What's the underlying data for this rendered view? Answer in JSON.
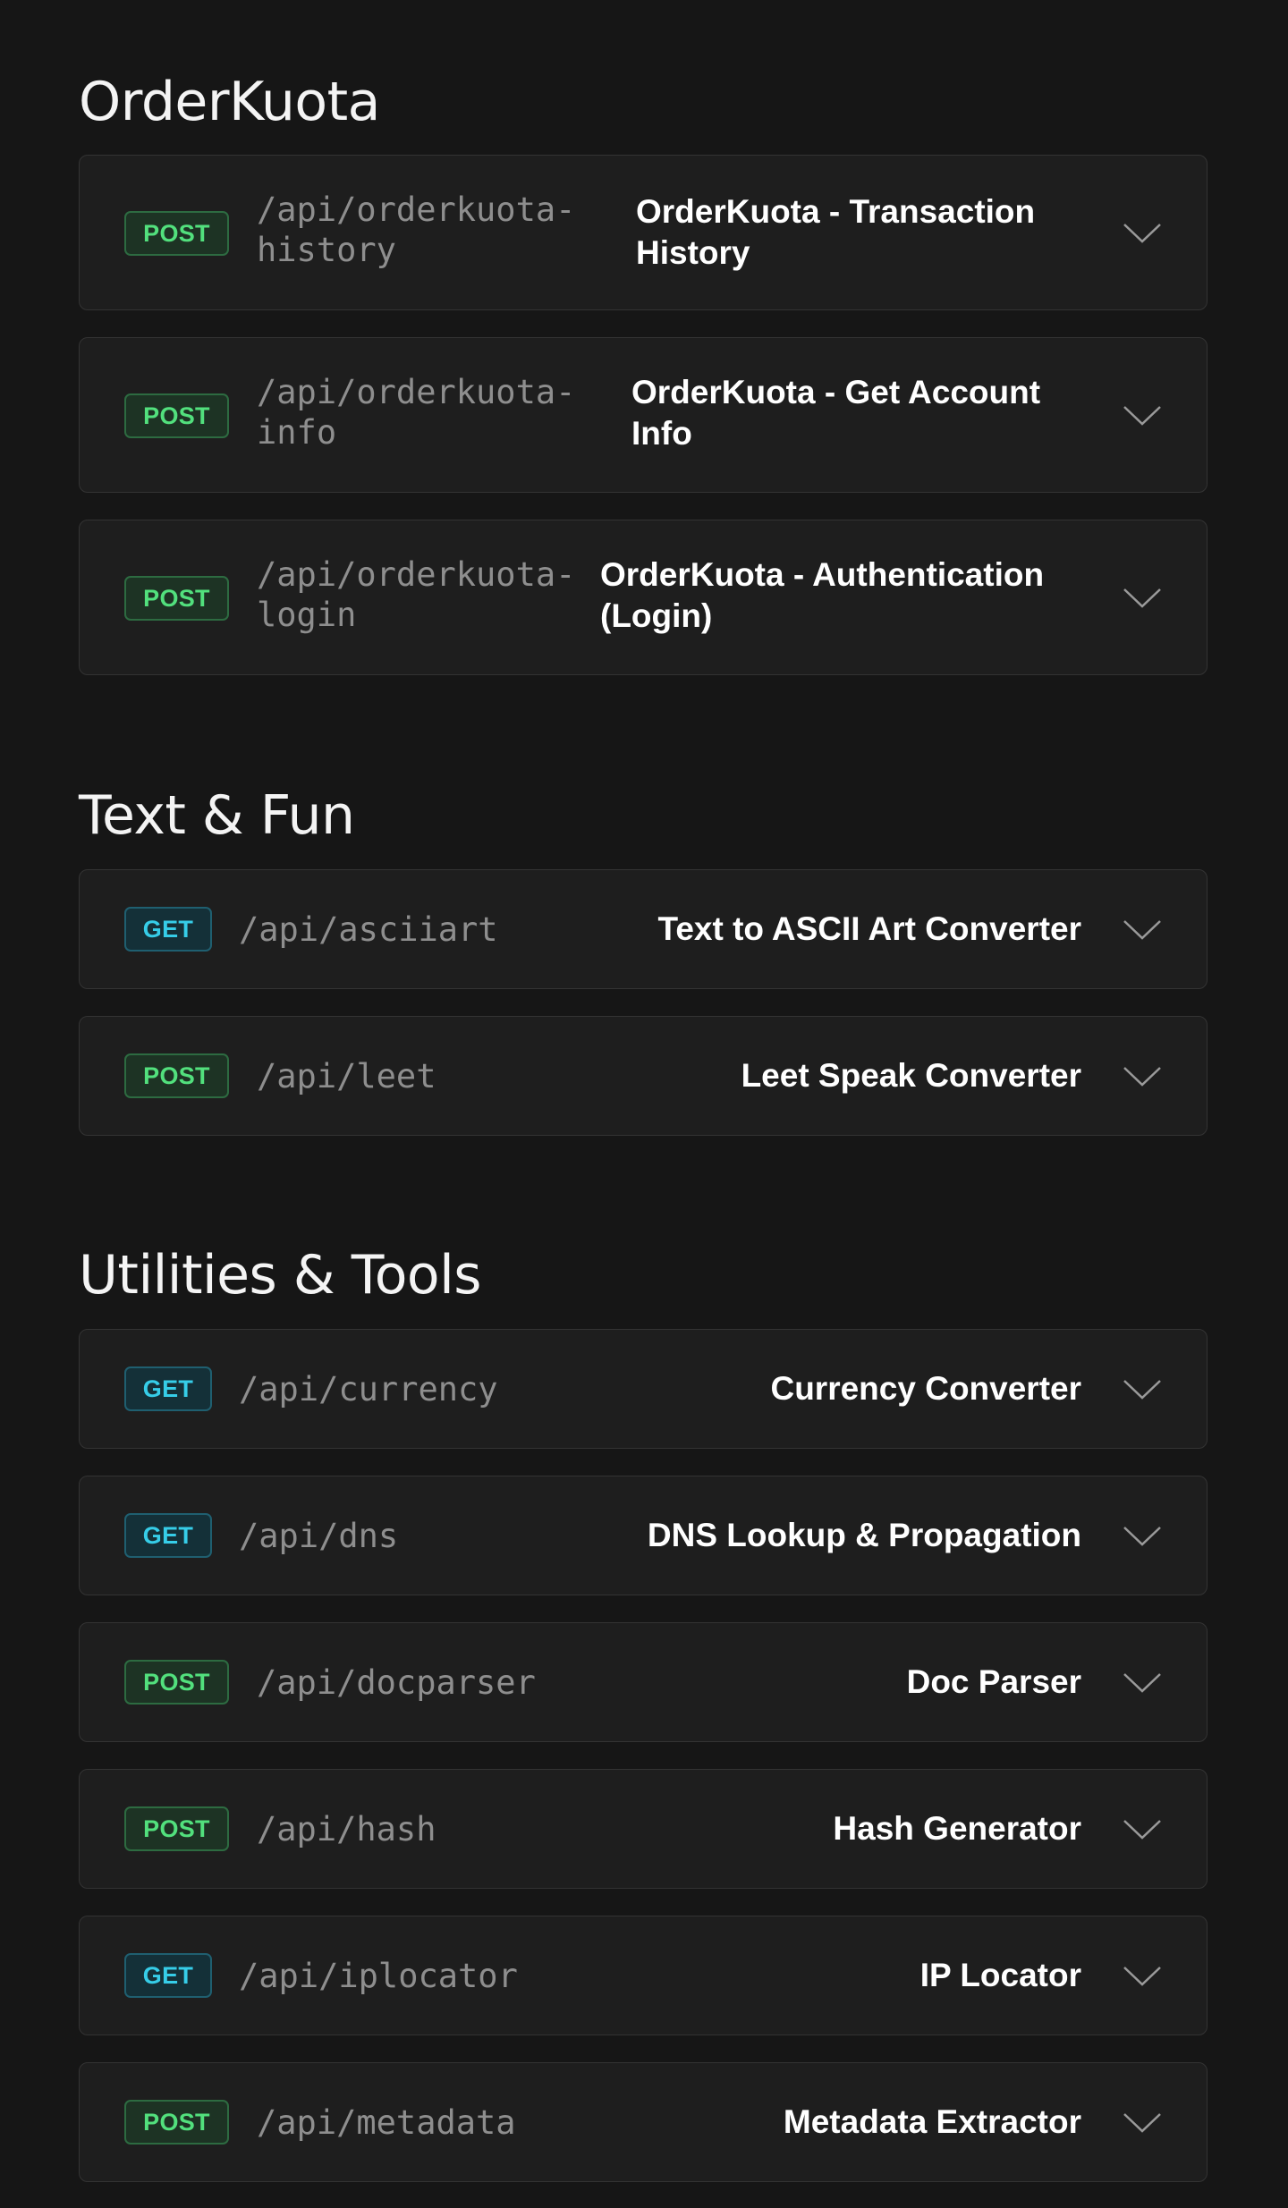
{
  "sections": [
    {
      "title": "OrderKuota",
      "endpoints": [
        {
          "method": "POST",
          "path": "/api/orderkuota-history",
          "path_line1": "/api/orderkuota-",
          "path_line2": "history",
          "desc_line1": "OrderKuota - Transaction",
          "desc_line2": "History"
        },
        {
          "method": "POST",
          "path": "/api/orderkuota-info",
          "path_line1": "/api/orderkuota-",
          "path_line2": "info",
          "desc_line1": "OrderKuota - Get Account",
          "desc_line2": "Info"
        },
        {
          "method": "POST",
          "path": "/api/orderkuota-login",
          "path_line1": "/api/orderkuota-",
          "path_line2": "login",
          "desc_line1": "OrderKuota - Authentication",
          "desc_line2": "(Login)"
        }
      ]
    },
    {
      "title": "Text & Fun",
      "endpoints": [
        {
          "method": "GET",
          "path": "/api/asciiart",
          "desc": "Text to ASCII Art Converter"
        },
        {
          "method": "POST",
          "path": "/api/leet",
          "desc": "Leet Speak Converter"
        }
      ]
    },
    {
      "title": "Utilities & Tools",
      "endpoints": [
        {
          "method": "GET",
          "path": "/api/currency",
          "desc": "Currency Converter"
        },
        {
          "method": "GET",
          "path": "/api/dns",
          "desc": "DNS Lookup & Propagation"
        },
        {
          "method": "POST",
          "path": "/api/docparser",
          "desc": "Doc Parser"
        },
        {
          "method": "POST",
          "path": "/api/hash",
          "desc": "Hash Generator"
        },
        {
          "method": "GET",
          "path": "/api/iplocator",
          "desc": "IP Locator"
        },
        {
          "method": "POST",
          "path": "/api/metadata",
          "desc": "Metadata Extractor"
        }
      ]
    }
  ],
  "icons": {
    "expand": "chevron-down-icon"
  },
  "colors": {
    "background": "#161616",
    "card": "#1e1e1e",
    "post": "#52e07d",
    "get": "#36cde8"
  }
}
